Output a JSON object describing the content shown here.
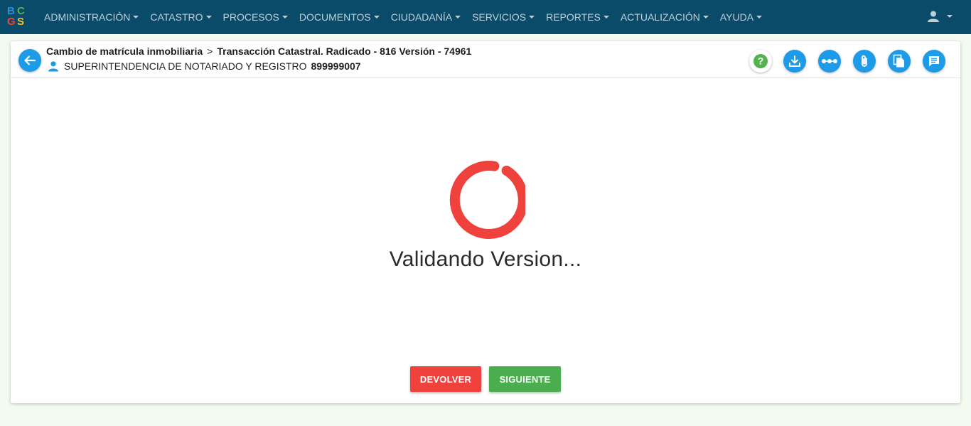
{
  "colors": {
    "navbar_bg": "#0b4b6a",
    "accent_blue": "#1e9be6",
    "spinner_red": "#f0423c",
    "button_red": "#f0423c",
    "button_green": "#4aae4e",
    "help_green": "#55b24f"
  },
  "logo": {
    "letters": [
      "B",
      "C",
      "G",
      "S"
    ]
  },
  "navbar": {
    "menu": [
      {
        "label": "ADMINISTRACIÓN"
      },
      {
        "label": "CATASTRO"
      },
      {
        "label": "PROCESOS"
      },
      {
        "label": "DOCUMENTOS"
      },
      {
        "label": "CIUDADANÍA"
      },
      {
        "label": "SERVICIOS"
      },
      {
        "label": "REPORTES"
      },
      {
        "label": "ACTUALIZACIÓN"
      },
      {
        "label": "AYUDA"
      }
    ],
    "user_icon": "user-icon"
  },
  "header": {
    "breadcrumb_parent": "Cambio de matrícula inmobiliaria",
    "breadcrumb_separator": ">",
    "breadcrumb_current": "Transacción Catastral. Radicado - 816 Versión - 74961",
    "entity_name": "SUPERINTENDENCIA DE NOTARIADO Y REGISTRO",
    "entity_id": "899999007"
  },
  "toolbar": {
    "help_icon": "question-icon",
    "help_label": "?",
    "download_icon": "download-icon",
    "flow_icon": "dots-flow-icon",
    "attach_icon": "paperclip-icon",
    "documents_icon": "documents-icon",
    "comments_icon": "comment-icon"
  },
  "main": {
    "loading_text": "Validando Version...",
    "return_label": "DEVOLVER",
    "next_label": "SIGUIENTE"
  }
}
